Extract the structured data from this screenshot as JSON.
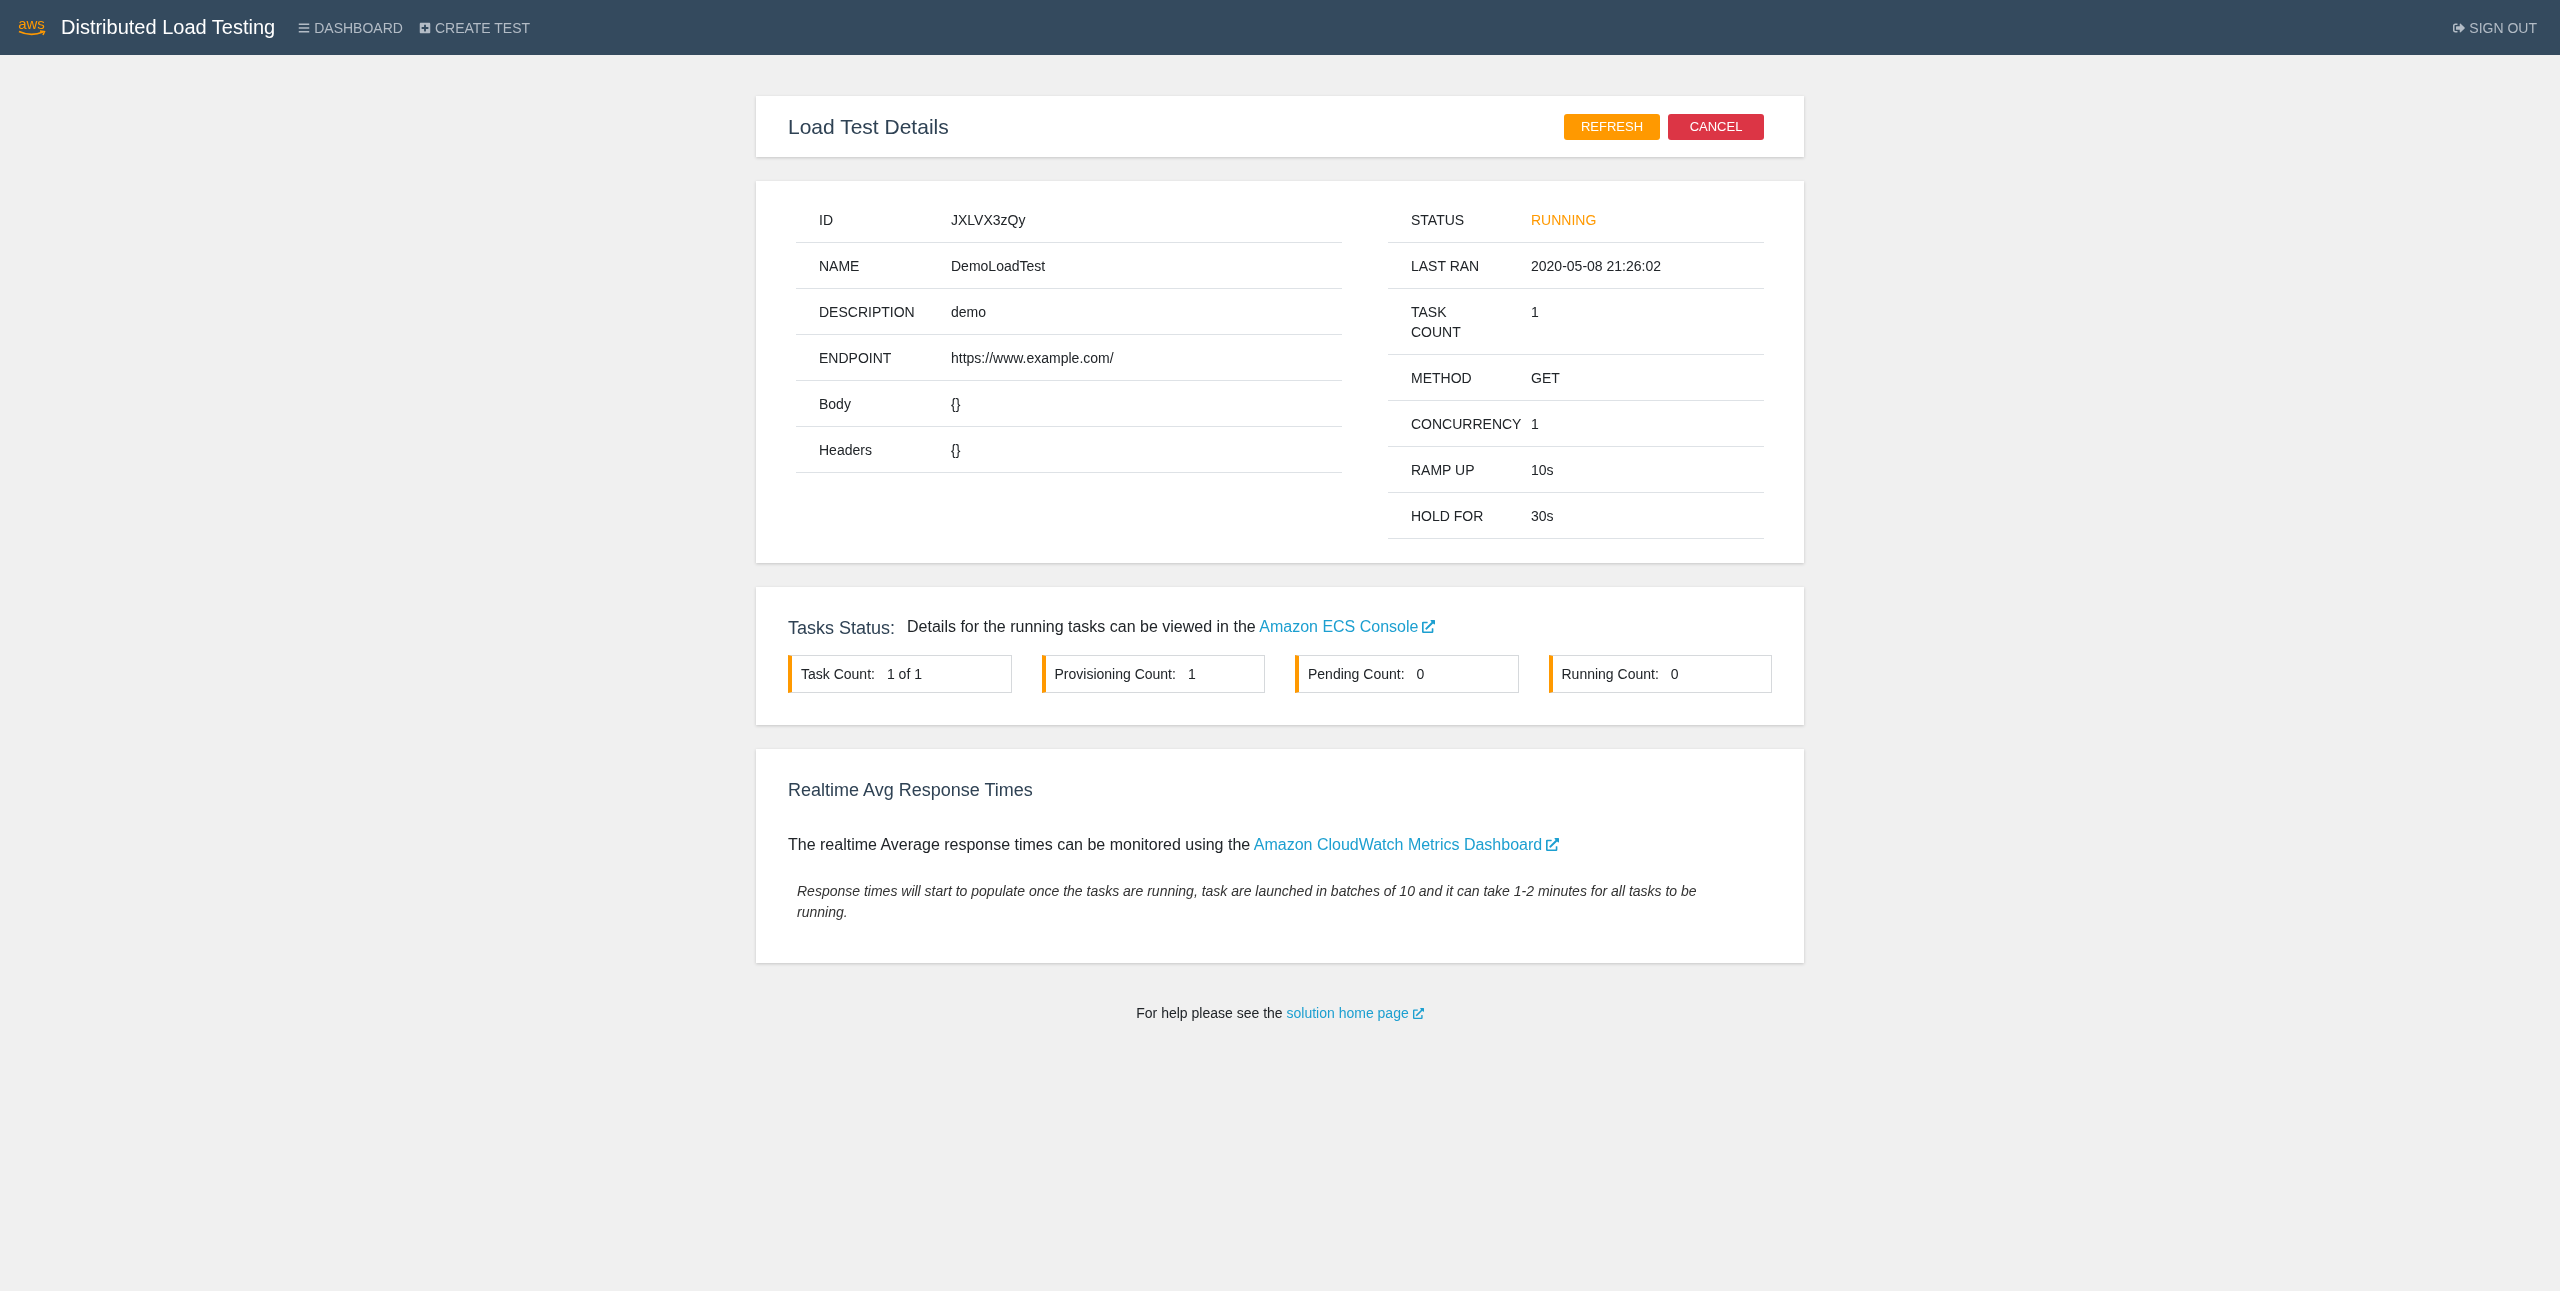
{
  "navbar": {
    "logo": "aws",
    "brand": "Distributed Load Testing",
    "links": [
      "DASHBOARD",
      "CREATE TEST"
    ],
    "sign_out": "SIGN OUT"
  },
  "header": {
    "title": "Load Test Details",
    "buttons": [
      {
        "label": "REFRESH",
        "kind": "warning"
      },
      {
        "label": "CANCEL",
        "kind": "danger"
      }
    ]
  },
  "details": {
    "left": [
      {
        "label": "ID",
        "value": "JXLVX3zQy",
        "kind": "text"
      },
      {
        "label": "NAME",
        "value": "DemoLoadTest",
        "kind": "text"
      },
      {
        "label": "DESCRIPTION",
        "value": "demo",
        "kind": "text"
      },
      {
        "label": "ENDPOINT",
        "value": "https://www.example.com/",
        "kind": "text"
      },
      {
        "label": "Body",
        "value": "{}",
        "kind": "text"
      },
      {
        "label": "Headers",
        "value": "{}",
        "kind": "text"
      }
    ],
    "right": [
      {
        "label": "STATUS",
        "value": "RUNNING",
        "kind": "status"
      },
      {
        "label": "LAST RAN",
        "value": "2020-05-08 21:26:02",
        "kind": "text"
      },
      {
        "label": "TASK COUNT",
        "value": "1",
        "kind": "text"
      },
      {
        "label": "METHOD",
        "value": "GET",
        "kind": "text"
      },
      {
        "label": "CONCURRENCY",
        "value": "1",
        "kind": "text"
      },
      {
        "label": "RAMP UP",
        "value": "10s",
        "kind": "text"
      },
      {
        "label": "HOLD FOR",
        "value": "30s",
        "kind": "text"
      }
    ]
  },
  "tasks_status": {
    "title": "Tasks Status:",
    "text": "Details for the running tasks can be viewed in the",
    "link": "Amazon ECS Console",
    "counts": [
      {
        "label": "Task Count:",
        "value": "1 of 1"
      },
      {
        "label": "Provisioning Count:",
        "value": "1"
      },
      {
        "label": "Pending Count:",
        "value": "0"
      },
      {
        "label": "Running Count:",
        "value": "0"
      }
    ]
  },
  "realtime": {
    "title": "Realtime Avg Response Times",
    "text": "The realtime Average response times can be monitored using the",
    "link": "Amazon CloudWatch Metrics Dashboard",
    "note": "Response times will start to populate once the tasks are running, task are launched in batches of 10 and it can take 1-2 minutes for all tasks to be running."
  },
  "footer": {
    "text": "For help please see the",
    "link": "solution home page"
  }
}
